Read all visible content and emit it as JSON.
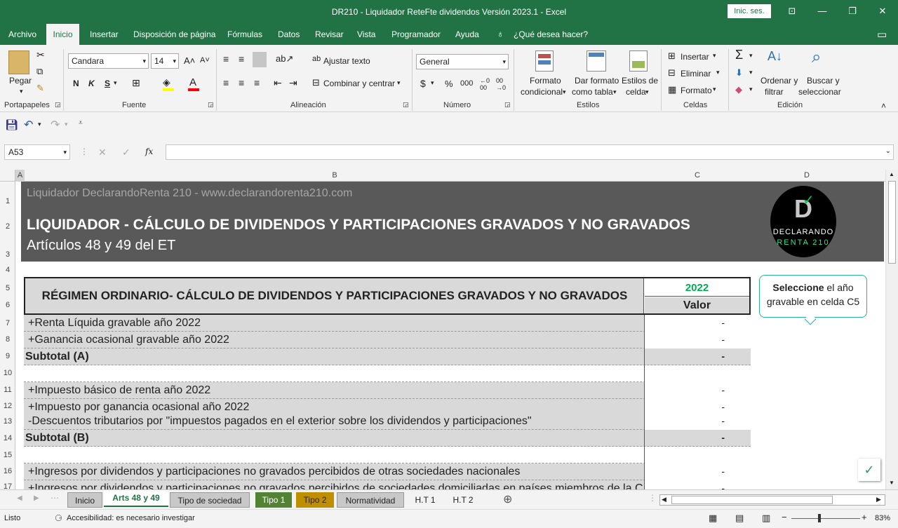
{
  "window": {
    "title": "DR210 - Liquidador ReteFte dividendos Versión 2023.1  -  Excel",
    "signin": "Inic. ses."
  },
  "ribbon_tabs": [
    "Archivo",
    "Inicio",
    "Insertar",
    "Disposición de página",
    "Fórmulas",
    "Datos",
    "Revisar",
    "Vista",
    "Programador",
    "Ayuda",
    "¿Qué desea hacer?"
  ],
  "ribbon": {
    "pegar": "Pegar",
    "portapapeles": "Portapapeles",
    "font_name": "Candara",
    "font_size": "14",
    "fuente": "Fuente",
    "bold": "N",
    "italic": "K",
    "underline": "S",
    "wrap": "Ajustar texto",
    "merge": "Combinar y centrar",
    "alineacion": "Alineación",
    "number_format": "General",
    "numero": "Número",
    "cond_format": [
      "Formato",
      "condicional"
    ],
    "table_format": [
      "Dar formato",
      "como tabla"
    ],
    "cell_styles": [
      "Estilos de",
      "celda"
    ],
    "estilos": "Estilos",
    "insert": "Insertar",
    "delete": "Eliminar",
    "format": "Formato",
    "celdas": "Celdas",
    "sort": [
      "Ordenar y",
      "filtrar"
    ],
    "find": [
      "Buscar y",
      "seleccionar"
    ],
    "edicion": "Edición"
  },
  "name_box": "A53",
  "columns": [
    "A",
    "B",
    "C",
    "D"
  ],
  "rows": [
    "1",
    "2",
    "3",
    "4",
    "5",
    "6",
    "7",
    "8",
    "9",
    "10",
    "11",
    "12",
    "13",
    "14",
    "15",
    "16",
    "17"
  ],
  "banner": {
    "site": "Liquidador DeclarandoRenta 210 - www.declarandorenta210.com",
    "title": "LIQUIDADOR - CÁLCULO DE DIVIDENDOS Y PARTICIPACIONES GRAVADOS Y NO GRAVADOS",
    "subtitle": "Artículos 48 y 49 del ET",
    "logo_text": [
      "DECLARANDO",
      "RENTA 210"
    ]
  },
  "table": {
    "header": "RÉGIMEN ORDINARIO- CÁLCULO DE DIVIDENDOS Y PARTICIPACIONES GRAVADOS Y NO GRAVADOS",
    "year": "2022",
    "value_header": "Valor",
    "rows": [
      {
        "label": "+Renta Líquida gravable año 2022",
        "value": "-"
      },
      {
        "label": "+Ganancia ocasional gravable año 2022",
        "value": "-"
      },
      {
        "label": "Subtotal (A)",
        "value": "-"
      },
      {
        "label": "",
        "value": ""
      },
      {
        "label": "+Impuesto básico de renta año 2022",
        "value": "-"
      },
      {
        "label": "+Impuesto por ganancia ocasional año 2022",
        "value": "-"
      },
      {
        "label": "-Descuentos tributarios por \"impuestos pagados en el exterior sobre los dividendos y participaciones\"",
        "value": "-"
      },
      {
        "label": "Subtotal (B)",
        "value": "-"
      },
      {
        "label": "",
        "value": ""
      },
      {
        "label": "+Ingresos por dividendos y participaciones no gravados percibidos de otras sociedades nacionales",
        "value": "-"
      },
      {
        "label": "+Ingresos por dividendos y participaciones no gravados percibidos de sociedades domiciliadas en países miembros de la CA",
        "value": "-"
      }
    ]
  },
  "callout": {
    "bold": "Seleccione",
    "rest": " el año gravable en celda C5"
  },
  "sheet_tabs": [
    "Inicio",
    "Arts 48 y 49",
    "Tipo de sociedad",
    "Tipo 1",
    "Tipo 2",
    "Normatividad",
    "H.T 1",
    "H.T 2"
  ],
  "colors": {
    "excel_green": "#217346",
    "banner": "#595959",
    "tipo1": "#548235",
    "tipo2": "#bf8f00",
    "year": "#00b050"
  },
  "status": {
    "ready": "Listo",
    "accessibility": "Accesibilidad: es necesario investigar",
    "zoom": "83%"
  }
}
